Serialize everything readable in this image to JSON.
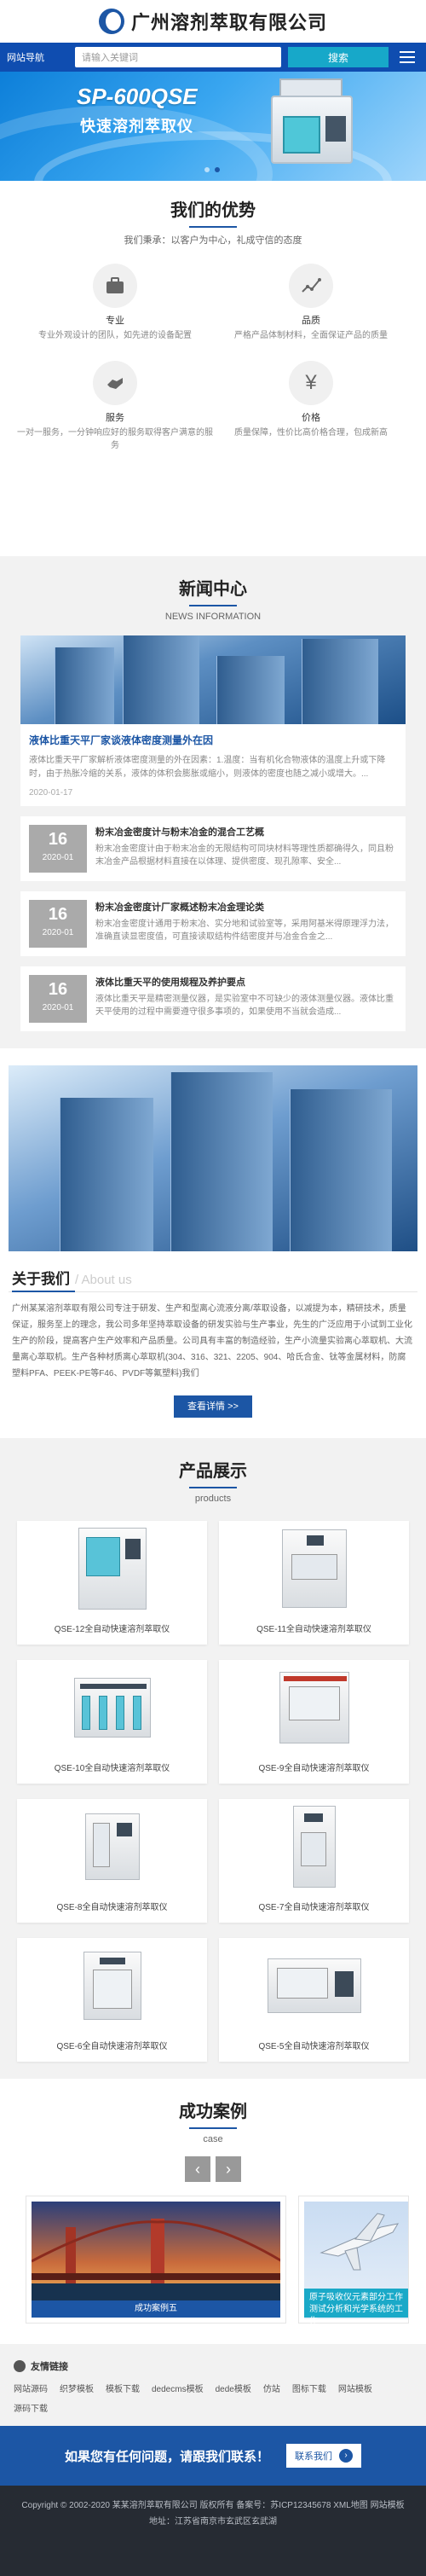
{
  "header": {
    "company_name": "广州溶剂萃取有限公司",
    "nav_label": "网站导航",
    "search_placeholder": "请输入关键词",
    "search_button": "搜索"
  },
  "banner": {
    "title": "SP-600QSE",
    "subtitle": "快速溶剂萃取仪",
    "active_slide": 2,
    "slide_count": 2
  },
  "advantages": {
    "title": "我们的优势",
    "subtitle": "我们秉承：以客户为中心，礼成守信的态度",
    "items": [
      {
        "icon": "briefcase-icon",
        "name": "专业",
        "desc": "专业外观设计的团队，如先进的设备配置"
      },
      {
        "icon": "chart-icon",
        "name": "品质",
        "desc": "严格产品体制材料，全面保证产品的质量"
      },
      {
        "icon": "handshake-icon",
        "name": "服务",
        "desc": "一对一服务，一分钟响应好的服务取得客户满意的服务"
      },
      {
        "icon": "yen-icon",
        "name": "价格",
        "desc": "质量保障，性价比高价格合理，包成新高"
      }
    ]
  },
  "news": {
    "title": "新闻中心",
    "subtitle": "NEWS INFORMATION",
    "featured": {
      "title": "液体比重天平厂家谈液体密度测量外在因",
      "summary": "液体比重天平厂家解析液体密度测量的外在因素：1.温度：当有机化合物液体的温度上升或下降时，由于热胀冷缩的关系，液体的体积会膨胀或缩小，则液体的密度也随之减小或增大。...",
      "date": "2020-01-17"
    },
    "items": [
      {
        "day": "16",
        "ym": "2020-01",
        "title": "粉末冶金密度计与粉末冶金的混合工艺概",
        "summary": "粉末冶金密度计由于粉末冶金的无限结构可同块材料等理性质都确得久，同且粉末冶金产品根据材料直接在以体理、提供密度、现孔隙率、安全..."
      },
      {
        "day": "16",
        "ym": "2020-01",
        "title": "粉末冶金密度计厂家概述粉末冶金理论类",
        "summary": "粉末冶金密度计通用于粉末冶、实分地和试验室等，采用阿基米得原理浮力法，准确直读显密度值，可直接读取结构件结密度并与冶金合金之..."
      },
      {
        "day": "16",
        "ym": "2020-01",
        "title": "液体比重天平的使用规程及养护要点",
        "summary": "液体比重天平是精密测量仪器，是实验室中不可缺少的液体测量仪器。液体比重天平使用的过程中需要遵守很多事项的，如果使用不当就会造成..."
      }
    ]
  },
  "about": {
    "title": "关于我们",
    "title_en": "/ About us",
    "text": "广州某某溶剂萃取有限公司专注于研发、生产和型离心流液分离/萃取设备，以减提为本，精研技术，质量保证，服务至上的理念，我公司多年坚持萃取设备的研发实验与生产事业，先生的广泛应用于小试到工业化生产的阶段，提高客户生产效率和产品质量。公司具有丰富的制造经验，生产小流量实验离心萃取机、大流量离心萃取机。生产各种材质离心萃取机(304、316、321、2205、904、哈氏合金、钛等金属材料，防腐塑料PFA、PEEK-PE等F46、PVDF等氟塑料)我们",
    "more_button": "查看详情 >>"
  },
  "products": {
    "title": "产品展示",
    "subtitle": "products",
    "items": [
      {
        "name": "QSE-12全自动快速溶剂萃取仪"
      },
      {
        "name": "QSE-11全自动快速溶剂萃取仪"
      },
      {
        "name": "QSE-10全自动快速溶剂萃取仪"
      },
      {
        "name": "QSE-9全自动快速溶剂萃取仪"
      },
      {
        "name": "QSE-8全自动快速溶剂萃取仪"
      },
      {
        "name": "QSE-7全自动快速溶剂萃取仪"
      },
      {
        "name": "QSE-6全自动快速溶剂萃取仪"
      },
      {
        "name": "QSE-5全自动快速溶剂萃取仪"
      }
    ]
  },
  "cases": {
    "title": "成功案例",
    "subtitle": "case",
    "prev": "‹",
    "next": "›",
    "items": [
      {
        "caption": "成功案例五"
      },
      {
        "caption": "原子吸收仪元素部分工作测试分析和光学系统的工作"
      }
    ]
  },
  "links": {
    "title": "友情链接",
    "items": [
      "网站源码",
      "织梦模板",
      "模板下载",
      "dedecms模板",
      "dede模板",
      "仿站",
      "图标下载",
      "网站模板",
      "源码下载"
    ]
  },
  "contact": {
    "text": "如果您有任何问题，请跟我们联系！",
    "button": "联系我们"
  },
  "footer": {
    "line1": "Copyright © 2002-2020 某某溶剂萃取有限公司 版权所有 备案号：苏ICP12345678 XML地图 网站模板",
    "line2": "地址：江苏省南京市玄武区玄武湖"
  },
  "colors": {
    "brand_blue": "#1c56a5",
    "nav_blue": "#0f4db0",
    "accent_teal": "#17a8c9",
    "footer_bg": "#262b33"
  }
}
